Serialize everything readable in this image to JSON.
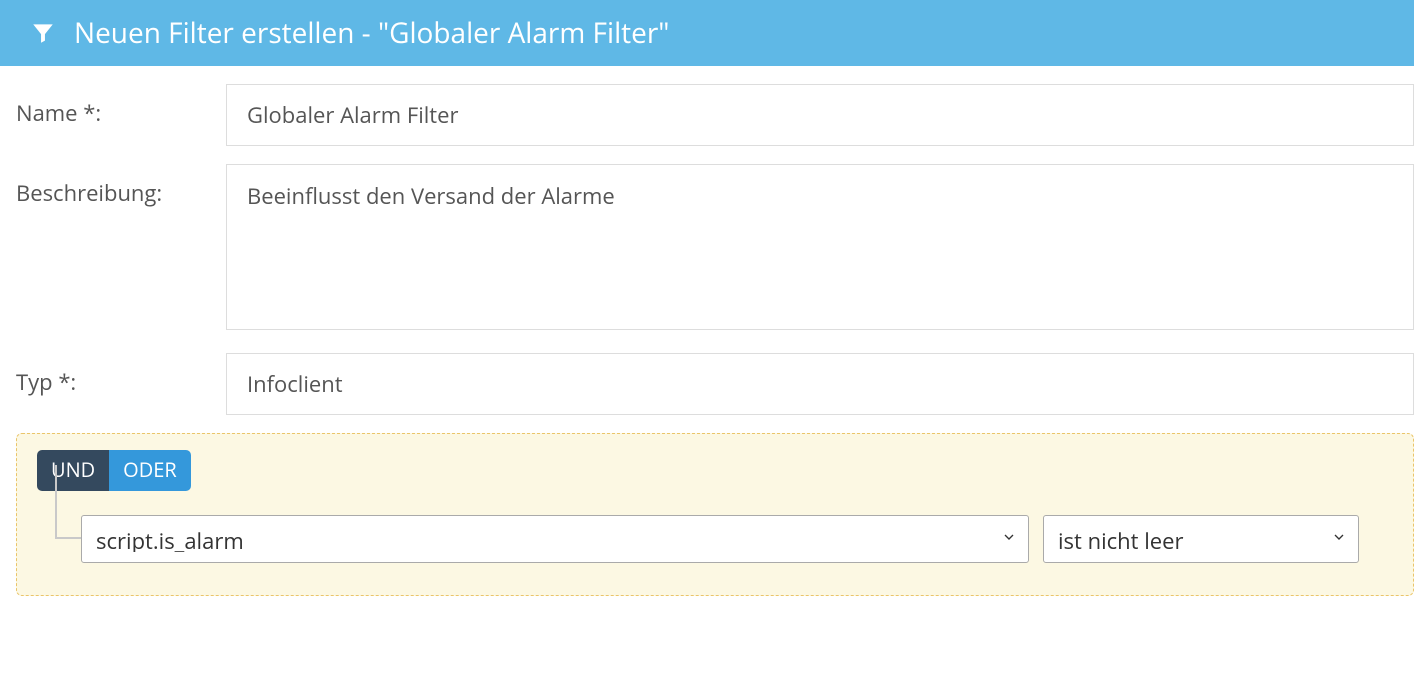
{
  "header": {
    "title": "Neuen Filter erstellen - \"Globaler Alarm Filter\""
  },
  "form": {
    "name_label": "Name *:",
    "name_value": "Globaler Alarm Filter",
    "desc_label": "Beschreibung:",
    "desc_value": "Beeinflusst den Versand der Alarme",
    "type_label": "Typ *:",
    "type_value": "Infoclient"
  },
  "rule": {
    "and_label": "UND",
    "or_label": "ODER",
    "field_value": "script.is_alarm",
    "operator_value": "ist nicht leer"
  }
}
